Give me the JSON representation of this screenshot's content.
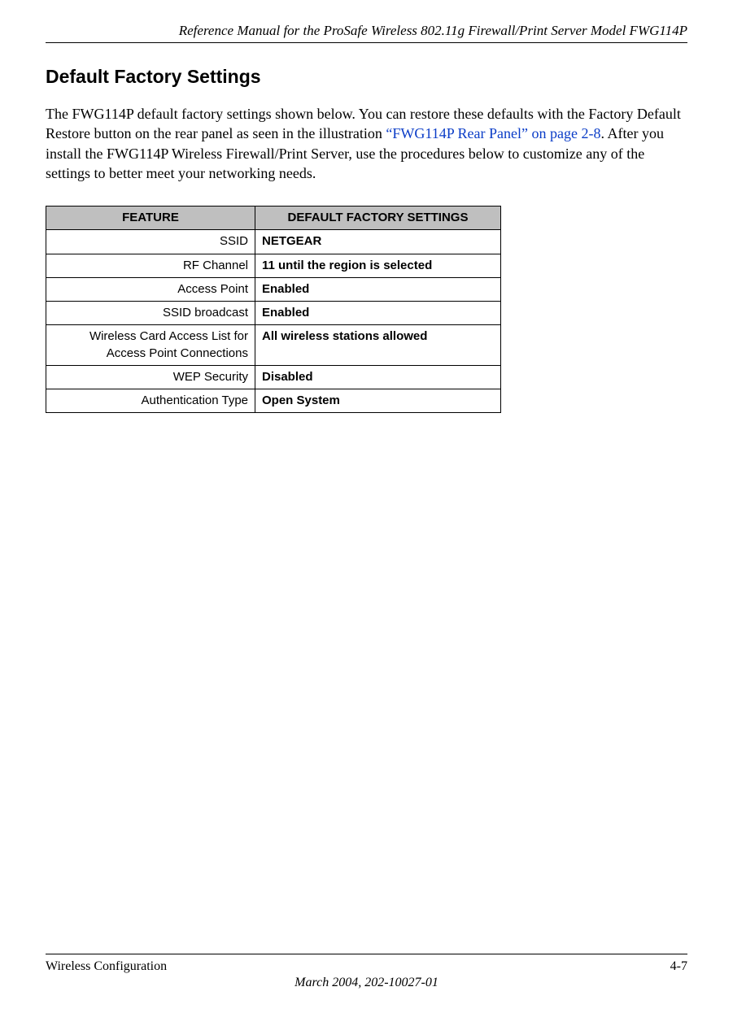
{
  "header": {
    "doc_title": "Reference Manual for the ProSafe Wireless 802.11g  Firewall/Print Server Model FWG114P"
  },
  "section": {
    "heading": "Default Factory Settings",
    "paragraph_pre": "The FWG114P default factory settings shown below. You can restore these defaults with the Factory Default Restore button on the rear panel as seen in the illustration ",
    "paragraph_link": "“FWG114P Rear Panel” on page 2-8",
    "paragraph_post": ". After you install the FWG114P Wireless Firewall/Print Server, use the procedures below to customize any of the settings to better meet your networking needs."
  },
  "table": {
    "col_feature": "FEATURE",
    "col_value": "DEFAULT FACTORY SETTINGS",
    "rows": [
      {
        "feature": "SSID",
        "value": "NETGEAR"
      },
      {
        "feature": "RF Channel",
        "value": "11 until the region is selected"
      },
      {
        "feature": "Access Point",
        "value": "Enabled"
      },
      {
        "feature": "SSID broadcast",
        "value": "Enabled"
      },
      {
        "feature": "Wireless Card Access List for Access Point Connections",
        "value": "All wireless stations allowed"
      },
      {
        "feature": "WEP Security",
        "value": "Disabled"
      },
      {
        "feature": "Authentication Type",
        "value": "Open System"
      }
    ]
  },
  "footer": {
    "left": "Wireless Configuration",
    "right": "4-7",
    "center": "March 2004, 202-10027-01"
  }
}
